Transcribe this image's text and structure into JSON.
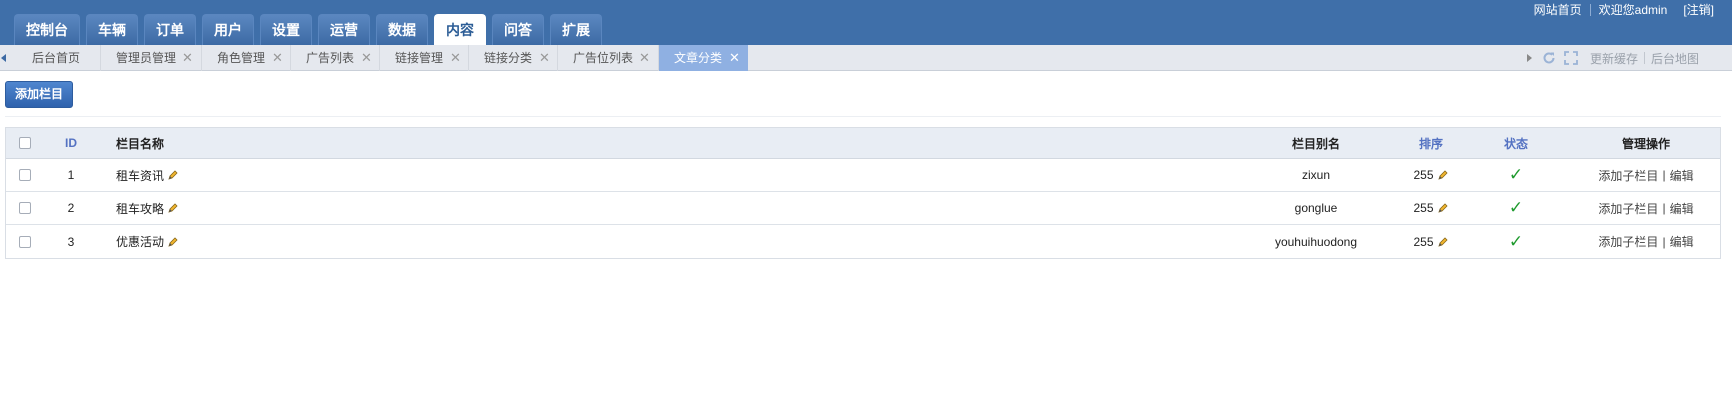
{
  "nav": {
    "tabs": [
      "控制台",
      "车辆",
      "订单",
      "用户",
      "设置",
      "运营",
      "数据",
      "内容",
      "问答",
      "扩展"
    ],
    "active": "内容"
  },
  "top_links": {
    "home": "网站首页",
    "welcome": "欢迎您admin",
    "logout": "[注销]"
  },
  "page_tabs": [
    {
      "label": "后台首页",
      "closable": false
    },
    {
      "label": "管理员管理",
      "closable": true
    },
    {
      "label": "角色管理",
      "closable": true
    },
    {
      "label": "广告列表",
      "closable": true
    },
    {
      "label": "链接管理",
      "closable": true
    },
    {
      "label": "链接分类",
      "closable": true
    },
    {
      "label": "广告位列表",
      "closable": true
    },
    {
      "label": "文章分类",
      "closable": true,
      "active": true
    }
  ],
  "strip_tools": {
    "refresh_cache": "更新缓存",
    "sitemap": "后台地图"
  },
  "toolbar": {
    "add_label": "添加栏目"
  },
  "table": {
    "headers": {
      "id": "ID",
      "name": "栏目名称",
      "alias": "栏目别名",
      "order": "排序",
      "status": "状态",
      "ops": "管理操作"
    },
    "rows": [
      {
        "id": "1",
        "name": "租车资讯",
        "alias": "zixun",
        "order": "255",
        "status": "✓",
        "add_child": "添加子栏目",
        "edit": "编辑"
      },
      {
        "id": "2",
        "name": "租车攻略",
        "alias": "gonglue",
        "order": "255",
        "status": "✓",
        "add_child": "添加子栏目",
        "edit": "编辑"
      },
      {
        "id": "3",
        "name": "优惠活动",
        "alias": "youhuihuodong",
        "order": "255",
        "status": "✓",
        "add_child": "添加子栏目",
        "edit": "编辑"
      }
    ]
  },
  "colors": {
    "header_bg": "#3f6fa9",
    "active_tab_bg": "#8fb0e2",
    "status_green": "#1f9a2e",
    "button_blue": "#2f62ad"
  }
}
